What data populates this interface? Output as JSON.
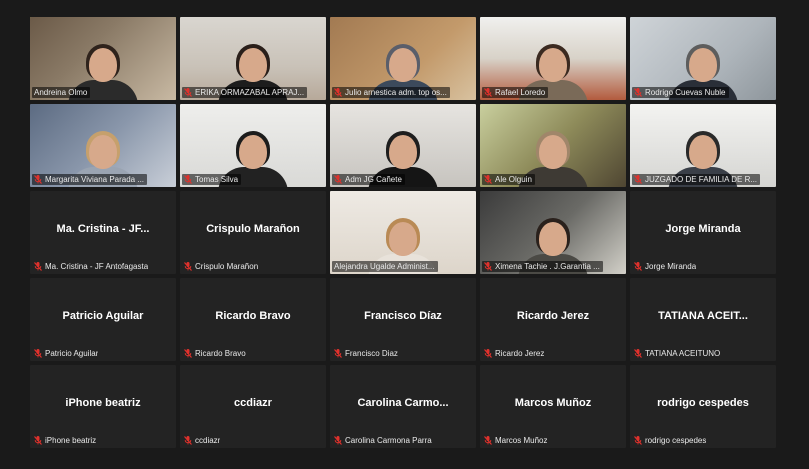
{
  "colors": {
    "background": "#1a1a1a",
    "tile": "#232323",
    "active_speaker_border": "#b9e34a",
    "muted_mic": "#e0312c"
  },
  "participants": [
    {
      "label": "Andreina Olmo",
      "video": true,
      "active": true,
      "muted": false,
      "bg": "linear-gradient(135deg,#6b5a48 0%,#8a7a66 40%,#c8b9a3 100%)",
      "hair": "#2f231c",
      "shirt": "#2b2b2b"
    },
    {
      "label": "ERIKA ORMAZABAL APRAJ...",
      "video": true,
      "muted": true,
      "bg": "linear-gradient(180deg,#d9d6d0 0%,#c9c2b8 60%,#b7a99a 100%)",
      "hair": "#2a1f1a",
      "shirt": "#1d1d1d"
    },
    {
      "label": "Julio arnestica adm. top os...",
      "video": true,
      "muted": true,
      "bg": "linear-gradient(135deg,#a27a52 0%,#c39a6b 60%,#d8c2a0 100%)",
      "hair": "#5a5e6a",
      "shirt": "#3c4a5c"
    },
    {
      "label": "Rafael Loredo",
      "video": true,
      "muted": true,
      "bg": "linear-gradient(180deg,#f0f0ee 0%,#d8d2c8 50%,#b35b3e 100%)",
      "hair": "#3b2a20",
      "shirt": "#7a6a58"
    },
    {
      "label": "Rodrigo Cuevas Nuble",
      "video": true,
      "muted": true,
      "bg": "linear-gradient(135deg,#cfd4d8 0%,#aeb5bb 60%,#8e969c 100%)",
      "hair": "#5d5d5d",
      "shirt": "#2a2f38"
    },
    {
      "label": "Margarita Viviana Parada ...",
      "video": true,
      "muted": true,
      "bg": "linear-gradient(135deg,#5c6b82 0%,#8a97ab 50%,#c9cfd8 100%)",
      "hair": "#c6a06c",
      "shirt": "#9aa4b2"
    },
    {
      "label": "Tomas Silva",
      "video": true,
      "muted": true,
      "bg": "linear-gradient(180deg,#eeeeec 0%,#d9d9d6 100%)",
      "hair": "#1c1c1c",
      "shirt": "#222222"
    },
    {
      "label": "Adm JG Cañete",
      "video": true,
      "muted": true,
      "bg": "linear-gradient(180deg,#e6e4e0 0%,#c7c4bf 100%)",
      "hair": "#1e1e1e",
      "shirt": "#151515"
    },
    {
      "label": "Ale Olguin",
      "video": true,
      "muted": true,
      "bg": "linear-gradient(135deg,#c9cf9e 0%,#8e8b5a 50%,#4f4632 100%)",
      "hair": "#a0866a",
      "shirt": "#3e3a34"
    },
    {
      "label": "JUZGADO DE FAMILIA DE R...",
      "video": true,
      "muted": true,
      "bg": "linear-gradient(180deg,#f3f3f1 0%,#d5d5d2 100%)",
      "hair": "#2a2a2a",
      "shirt": "#3a3f48"
    },
    {
      "label": "Ma. Cristina - JF Antofagasta",
      "name": "Ma. Cristina - JF...",
      "video": false,
      "muted": true
    },
    {
      "label": "Crispulo Marañon",
      "name": "Crispulo Marañon",
      "video": false,
      "muted": true
    },
    {
      "label": "Alejandra Ugalde Administ...",
      "video": true,
      "muted": false,
      "bg": "linear-gradient(180deg,#eeeae4 0%,#ddd5ca 100%)",
      "hair": "#b98a55",
      "shirt": "#e8e2da"
    },
    {
      "label": "Ximena Tachie . J.Garantia ...",
      "video": true,
      "muted": true,
      "bg": "linear-gradient(135deg,#3b3b3b 0%,#6a6a66 50%,#d2d0c8 100%)",
      "hair": "#2a211c",
      "shirt": "#4b4a45"
    },
    {
      "label": "Jorge Miranda",
      "name": "Jorge Miranda",
      "video": false,
      "muted": true
    },
    {
      "label": "Patricio Aguilar",
      "name": "Patricio Aguilar",
      "video": false,
      "muted": true
    },
    {
      "label": "Ricardo Bravo",
      "name": "Ricardo Bravo",
      "video": false,
      "muted": true
    },
    {
      "label": "Francisco Diaz",
      "name": "Francisco Díaz",
      "video": false,
      "muted": true
    },
    {
      "label": "Ricardo Jerez",
      "name": "Ricardo Jerez",
      "video": false,
      "muted": true
    },
    {
      "label": "TATIANA ACEITUNO",
      "name": "TATIANA ACEIT...",
      "video": false,
      "muted": true
    },
    {
      "label": "iPhone beatriz",
      "name": "iPhone beatriz",
      "video": false,
      "muted": true
    },
    {
      "label": "ccdiazr",
      "name": "ccdiazr",
      "video": false,
      "muted": true
    },
    {
      "label": "Carolina Carmona Parra",
      "name": "Carolina Carmo...",
      "video": false,
      "muted": true
    },
    {
      "label": "Marcos Muñoz",
      "name": "Marcos Muñoz",
      "video": false,
      "muted": true
    },
    {
      "label": "rodrigo cespedes",
      "name": "rodrigo cespedes",
      "video": false,
      "muted": true
    }
  ]
}
